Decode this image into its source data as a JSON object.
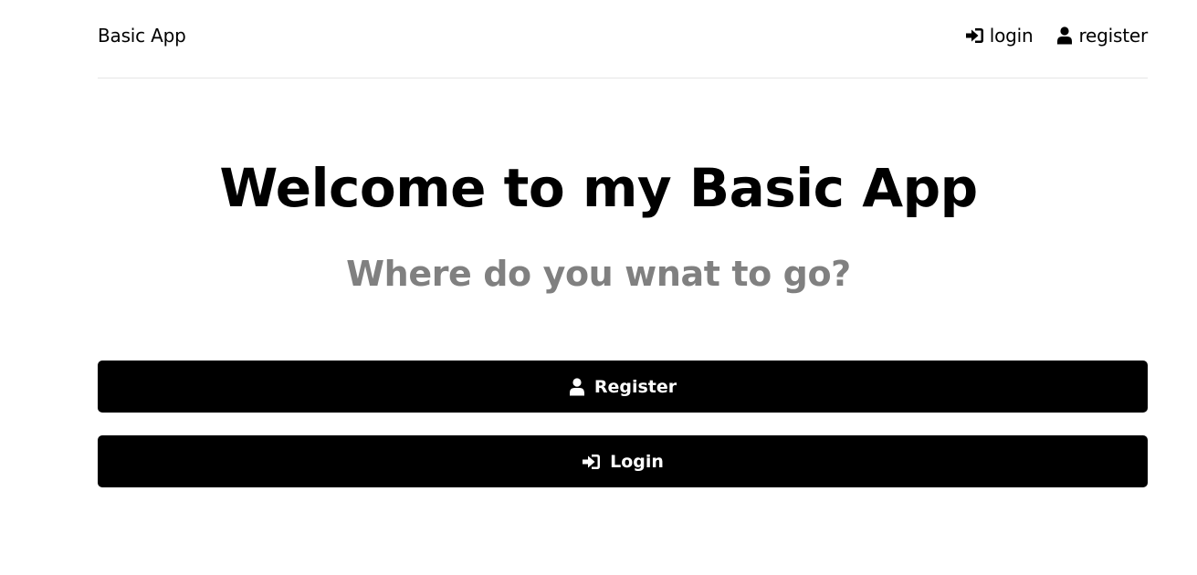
{
  "navbar": {
    "brand": "Basic App",
    "links": {
      "login_label": "login",
      "register_label": "register"
    }
  },
  "hero": {
    "title": "Welcome to my Basic App",
    "subtitle": "Where do you wnat to go?"
  },
  "actions": {
    "register_label": "Register",
    "login_label": "Login"
  },
  "icons": {
    "login": "sign-in-icon",
    "register": "user-icon"
  },
  "colors": {
    "background": "#ffffff",
    "text": "#000000",
    "subtitle": "#808080",
    "button_bg": "#000000",
    "button_text": "#ffffff",
    "divider": "#e6e6e6"
  }
}
